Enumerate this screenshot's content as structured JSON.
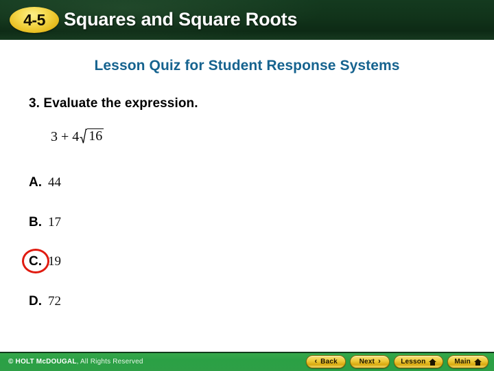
{
  "header": {
    "lesson_number": "4-5",
    "title": "Squares and Square Roots",
    "bg_color": "#11331a",
    "badge_color": "#eecb3a"
  },
  "content": {
    "subtitle": "Lesson Quiz for Student Response Systems",
    "subtitle_color": "#16638f",
    "question": {
      "number": "3.",
      "prompt": "3. Evaluate the expression.",
      "expression": {
        "plain": "3 + 4√16",
        "lead_term": "3",
        "operator": "+",
        "coefficient": "4",
        "radicand": "16",
        "radical_symbol": "square-root"
      }
    },
    "options": [
      {
        "letter": "A.",
        "value": "44",
        "selected": false
      },
      {
        "letter": "B.",
        "value": "17",
        "selected": false
      },
      {
        "letter": "C.",
        "value": "19",
        "selected": true
      },
      {
        "letter": "D.",
        "value": "72",
        "selected": false
      }
    ],
    "selection_ring_color": "#e01b10"
  },
  "footer": {
    "copyright_brand": "© HOLT McDOUGAL",
    "copyright_rest": ", All Rights Reserved",
    "bg_color": "#2ba045",
    "buttons": [
      {
        "label": "Back",
        "icon": "chevron-left-icon",
        "glyph": "‹"
      },
      {
        "label": "Next",
        "icon": "chevron-right-icon",
        "glyph": "›"
      },
      {
        "label": "Lesson",
        "icon": "home-icon",
        "glyph": ""
      },
      {
        "label": "Main",
        "icon": "home-icon",
        "glyph": ""
      }
    ]
  }
}
